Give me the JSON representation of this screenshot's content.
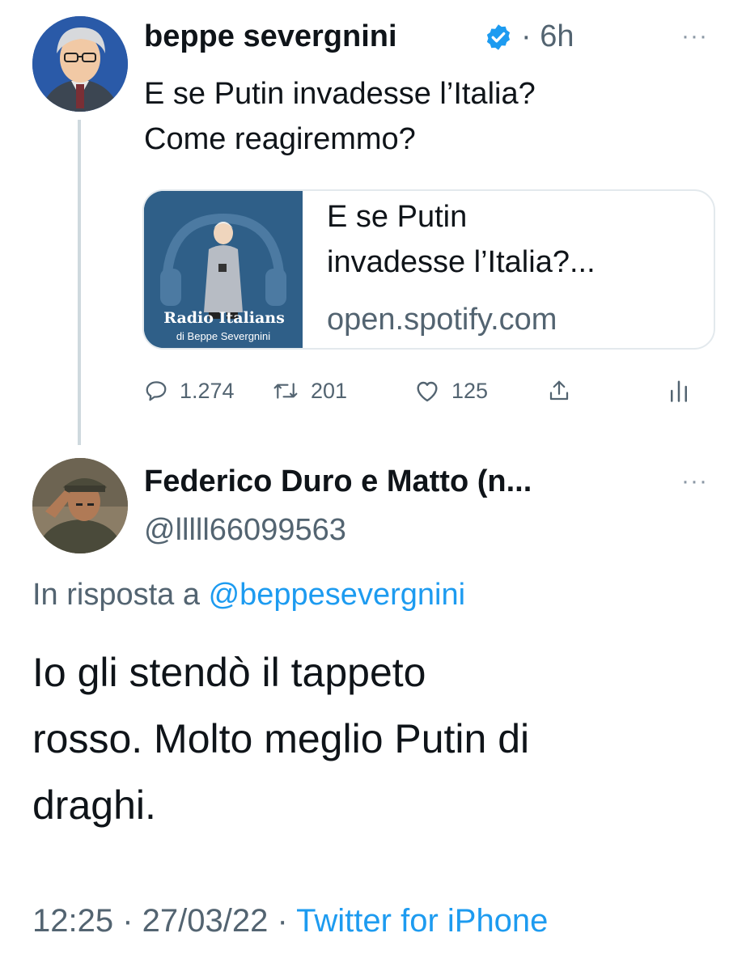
{
  "tweet": {
    "author_name": "beppe severgnini",
    "verified_icon": "verified-badge-icon",
    "time": "· 6h",
    "more": "···",
    "text": "E se Putin invadesse l’Italia?\nCome reagiremmo?",
    "card": {
      "title": "E se Putin\ninvadesse l’Italia?...",
      "domain": "open.spotify.com",
      "thumb_title": "Radio Italians",
      "thumb_subtitle": "di Beppe Severgnini"
    },
    "actions": {
      "replies": "1.274",
      "retweets": "201",
      "likes": "125"
    }
  },
  "reply": {
    "author_name": "Federico Duro e Matto (n...",
    "handle": "@lllll66099563",
    "more": "···",
    "reply_prefix": "In risposta a ",
    "reply_mention": "@beppesevergnini",
    "text": "Io gli stendò il tappeto\nrosso. Molto meglio Putin di\ndraghi.",
    "timestamp": "12:25 · 27/03/22 · ",
    "source": "Twitter for iPhone"
  },
  "colors": {
    "text": "#0f1419",
    "secondary": "#536471",
    "link": "#1d9bf0",
    "verified": "#1d9bf0",
    "border": "#e3e9ed"
  }
}
